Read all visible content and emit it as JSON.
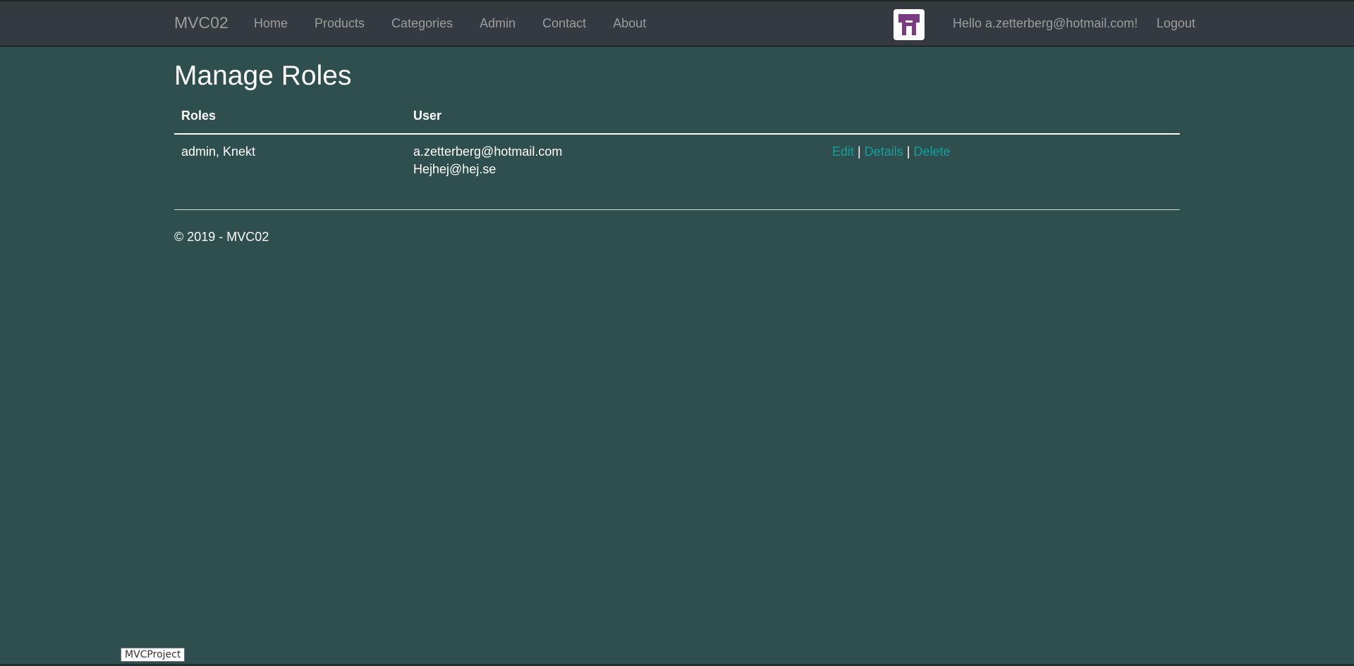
{
  "navbar": {
    "brand": "MVC02",
    "links": [
      "Home",
      "Products",
      "Categories",
      "Admin",
      "Contact",
      "About"
    ],
    "greeting": "Hello a.zetterberg@hotmail.com!",
    "logout": "Logout",
    "avatar_icon": "pixel-avatar-icon",
    "avatar_color": "#7a3b82"
  },
  "page": {
    "title": "Manage Roles"
  },
  "table": {
    "headers": [
      "Roles",
      "User",
      ""
    ],
    "rows": [
      {
        "roles": "admin, Knekt",
        "users": [
          "a.zetterberg@hotmail.com",
          "Hejhej@hej.se"
        ],
        "actions": [
          "Edit",
          "Details",
          "Delete"
        ],
        "separator": "|"
      }
    ]
  },
  "footer": {
    "copyright": "© 2019 - MVC02"
  },
  "tooltip": {
    "text": "MVCProject"
  },
  "colors": {
    "background": "#2f4f4f",
    "navbar": "#343a40",
    "link": "#169f9f"
  }
}
